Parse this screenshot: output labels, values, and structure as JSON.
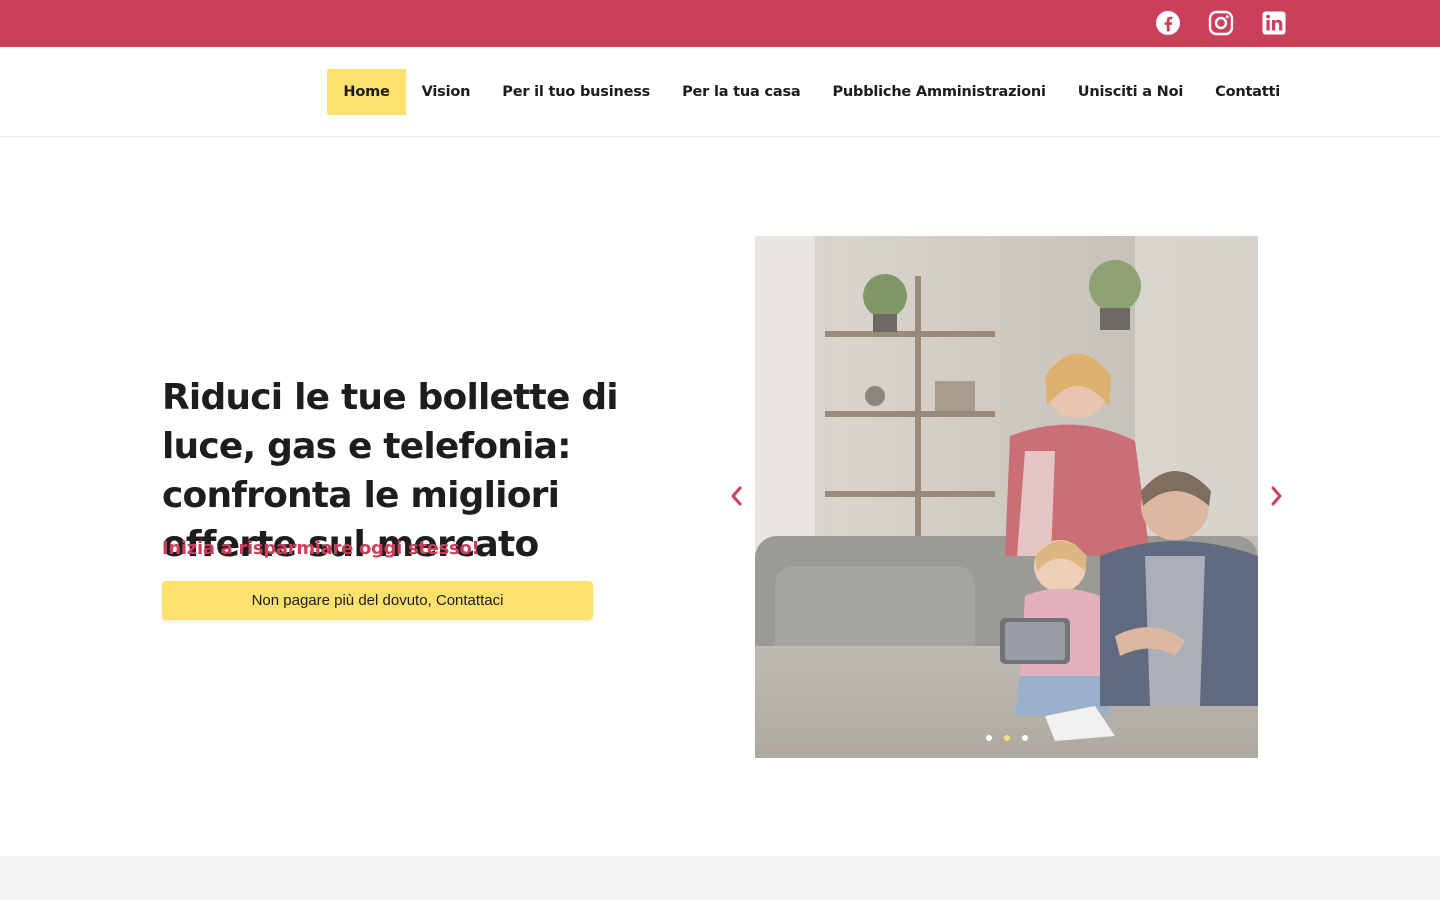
{
  "colors": {
    "brand": "#cc3f5b",
    "accent": "#fde16d",
    "text": "#1d1d1d"
  },
  "social": [
    {
      "name": "facebook-icon",
      "label": "Facebook"
    },
    {
      "name": "instagram-icon",
      "label": "Instagram"
    },
    {
      "name": "linkedin-icon",
      "label": "LinkedIn"
    }
  ],
  "nav": {
    "items": [
      {
        "label": "Home",
        "active": true
      },
      {
        "label": "Vision"
      },
      {
        "label": "Per il tuo business"
      },
      {
        "label": "Per la tua casa"
      },
      {
        "label": "Pubbliche Amministrazioni"
      },
      {
        "label": "Unisciti a Noi"
      },
      {
        "label": "Contatti"
      }
    ]
  },
  "hero": {
    "title": "Riduci le tue bollette di luce, gas e telefonia: confronta le migliori offerte sul mercato",
    "subtitle": "Inizia a risparmiare oggi stesso!",
    "cta_label": "Non pagare più del dovuto, Contattaci"
  },
  "slider": {
    "prev_icon": "chevron-left-icon",
    "next_icon": "chevron-right-icon",
    "slide_count": 3,
    "active_slide": 2
  }
}
